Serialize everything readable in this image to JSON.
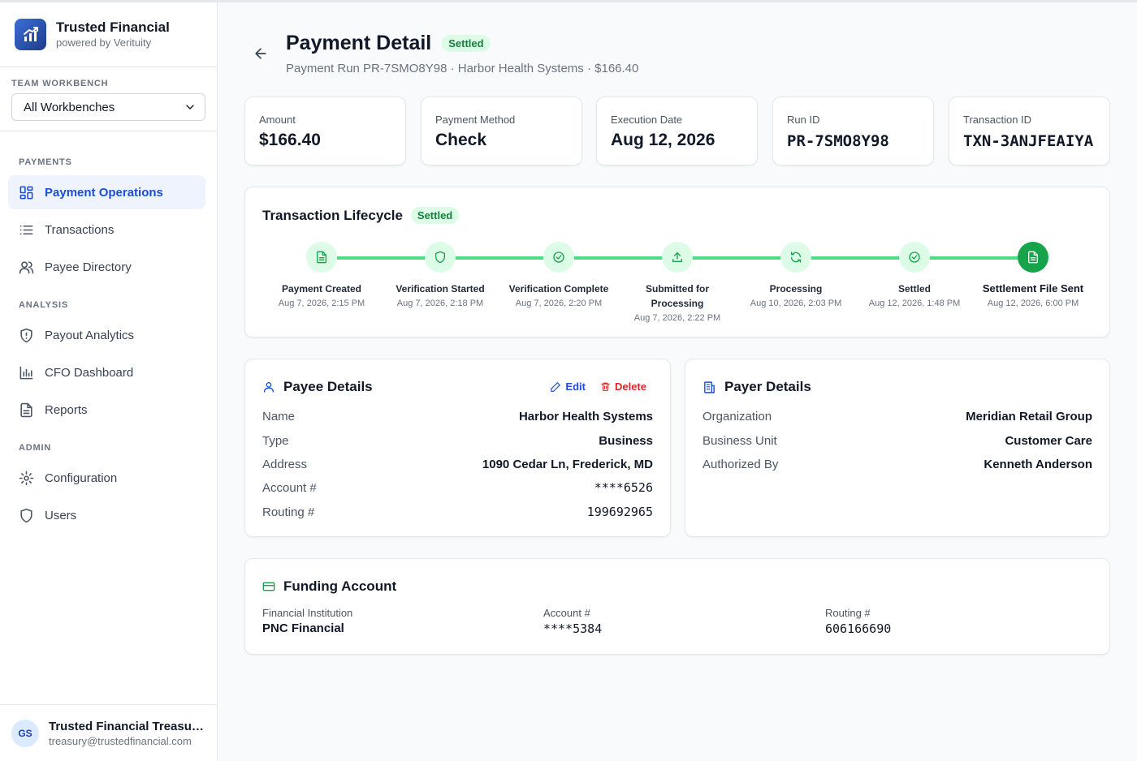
{
  "brand": {
    "name": "Trusted Financial",
    "sub": "powered by Verituity"
  },
  "workbench": {
    "label": "TEAM WORKBENCH",
    "selected": "All Workbenches"
  },
  "nav": {
    "payments_label": "PAYMENTS",
    "analysis_label": "ANALYSIS",
    "admin_label": "ADMIN",
    "items": [
      {
        "label": "Payment Operations",
        "icon": "grid-icon"
      },
      {
        "label": "Transactions",
        "icon": "list-icon"
      },
      {
        "label": "Payee Directory",
        "icon": "users-icon"
      },
      {
        "label": "Payout Analytics",
        "icon": "shield-alert-icon"
      },
      {
        "label": "CFO Dashboard",
        "icon": "bar-chart-icon"
      },
      {
        "label": "Reports",
        "icon": "document-icon"
      },
      {
        "label": "Configuration",
        "icon": "gear-icon"
      },
      {
        "label": "Users",
        "icon": "shield-icon"
      }
    ]
  },
  "user": {
    "initials": "GS",
    "name": "Trusted Financial Treasury Team",
    "email": "treasury@trustedfinancial.com"
  },
  "header": {
    "title": "Payment Detail",
    "status": "Settled",
    "subtitle": "Payment Run PR-7SMO8Y98 · Harbor Health Systems · $166.40"
  },
  "stats": [
    {
      "label": "Amount",
      "value": "$166.40"
    },
    {
      "label": "Payment Method",
      "value": "Check"
    },
    {
      "label": "Execution Date",
      "value": "Aug 12, 2026"
    },
    {
      "label": "Run ID",
      "value": "PR-7SMO8Y98"
    },
    {
      "label": "Transaction ID",
      "value": "TXN-3ANJFEAIYA"
    }
  ],
  "lifecycle": {
    "title": "Transaction Lifecycle",
    "status": "Settled",
    "steps": [
      {
        "label": "Payment Created",
        "time": "Aug 7, 2026, 2:15 PM",
        "icon": "document-icon"
      },
      {
        "label": "Verification Started",
        "time": "Aug 7, 2026, 2:18 PM",
        "icon": "shield-icon"
      },
      {
        "label": "Verification Complete",
        "time": "Aug 7, 2026, 2:20 PM",
        "icon": "check-circle-icon"
      },
      {
        "label": "Submitted for Processing",
        "time": "Aug 7, 2026, 2:22 PM",
        "icon": "upload-icon"
      },
      {
        "label": "Processing",
        "time": "Aug 10, 2026, 2:03 PM",
        "icon": "refresh-icon"
      },
      {
        "label": "Settled",
        "time": "Aug 12, 2026, 1:48 PM",
        "icon": "check-circle-icon"
      },
      {
        "label": "Settlement File Sent",
        "time": "Aug 12, 2026, 6:00 PM",
        "icon": "document-icon"
      }
    ]
  },
  "payee": {
    "title": "Payee Details",
    "edit_label": "Edit",
    "delete_label": "Delete",
    "rows": [
      {
        "key": "Name",
        "value": "Harbor Health Systems"
      },
      {
        "key": "Type",
        "value": "Business"
      },
      {
        "key": "Address",
        "value": "1090 Cedar Ln, Frederick, MD"
      },
      {
        "key": "Account #",
        "value": "****6526"
      },
      {
        "key": "Routing #",
        "value": "199692965"
      }
    ]
  },
  "payer": {
    "title": "Payer Details",
    "rows": [
      {
        "key": "Organization",
        "value": "Meridian Retail Group"
      },
      {
        "key": "Business Unit",
        "value": "Customer Care"
      },
      {
        "key": "Authorized By",
        "value": "Kenneth Anderson"
      }
    ]
  },
  "funding": {
    "title": "Funding Account",
    "cols": [
      {
        "key": "Financial Institution",
        "value": "PNC Financial"
      },
      {
        "key": "Account #",
        "value": "****5384"
      },
      {
        "key": "Routing #",
        "value": "606166690"
      }
    ]
  },
  "colors": {
    "accent": "#1d4ed8",
    "success": "#16a34a",
    "success_light": "#dcfce7",
    "danger": "#dc2626"
  }
}
